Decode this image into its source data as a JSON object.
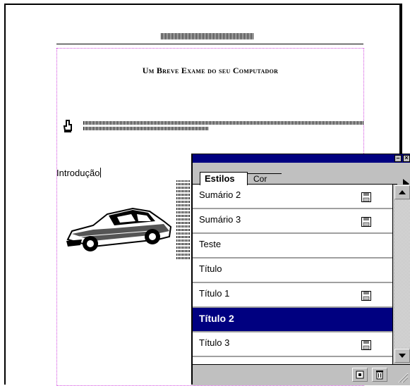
{
  "document": {
    "title": "Um Breve Exame do seu Computador",
    "intro": "Introdução"
  },
  "palette": {
    "tabs": [
      {
        "label": "Estilos",
        "active": true
      },
      {
        "label": "Cor",
        "active": false
      }
    ],
    "styles": [
      {
        "label": "Sumário 2",
        "save_icon": true
      },
      {
        "label": "Sumário 3",
        "save_icon": true
      },
      {
        "label": "Teste",
        "save_icon": false
      },
      {
        "label": "Título",
        "save_icon": false
      },
      {
        "label": "Título 1",
        "save_icon": true
      },
      {
        "label": "Título 2",
        "save_icon": false,
        "selected": true
      },
      {
        "label": "Título 3",
        "save_icon": true
      }
    ],
    "icons": {
      "minimize": "minimize-icon",
      "close": "close-icon",
      "menu": "triangle-right-icon",
      "scroll_up": "arrow-up-icon",
      "scroll_down": "arrow-down-icon",
      "new_style": "new-style-icon",
      "delete": "trash-icon"
    },
    "colors": {
      "titlebar": "#000080",
      "selection": "#000080",
      "chrome": "#c0c0c0"
    }
  }
}
